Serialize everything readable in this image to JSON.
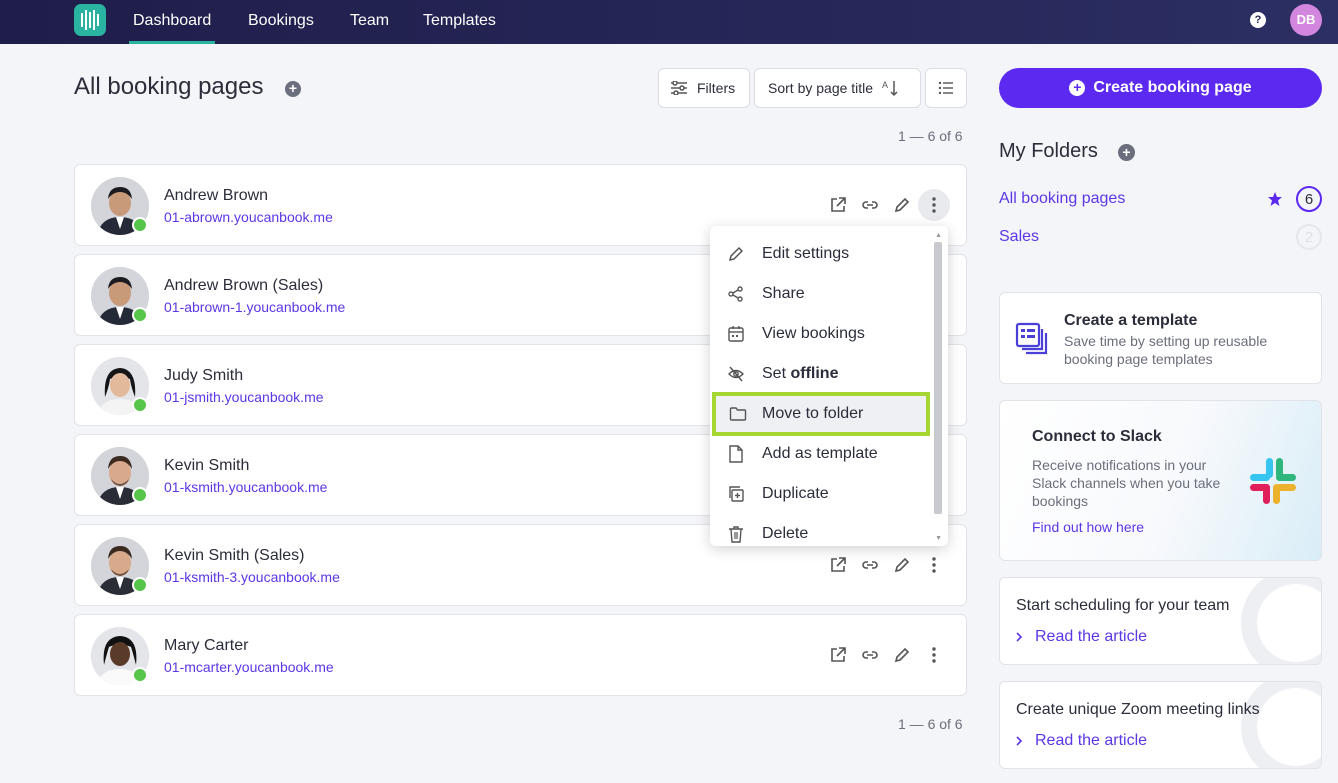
{
  "nav": {
    "items": [
      "Dashboard",
      "Bookings",
      "Team",
      "Templates"
    ],
    "help_label": "?",
    "user_initials": "DB"
  },
  "header": {
    "title": "All booking pages",
    "filters_label": "Filters",
    "sort_label": "Sort by page title",
    "count_top": "1 — 6 of 6",
    "count_bottom": "1 — 6 of 6"
  },
  "rows": [
    {
      "name": "Andrew Brown",
      "url": "01-abrown.youcanbook.me"
    },
    {
      "name": "Andrew Brown (Sales)",
      "url": "01-abrown-1.youcanbook.me"
    },
    {
      "name": "Judy Smith",
      "url": "01-jsmith.youcanbook.me"
    },
    {
      "name": "Kevin Smith",
      "url": "01-ksmith.youcanbook.me"
    },
    {
      "name": "Kevin Smith (Sales)",
      "url": "01-ksmith-3.youcanbook.me"
    },
    {
      "name": "Mary Carter",
      "url": "01-mcarter.youcanbook.me"
    }
  ],
  "menu": {
    "edit": "Edit settings",
    "share": "Share",
    "view": "View bookings",
    "offline_prefix": "Set ",
    "offline_bold": "offline",
    "move": "Move to folder",
    "template": "Add as template",
    "duplicate": "Duplicate",
    "delete": "Delete"
  },
  "sidebar": {
    "create_label": "Create booking page",
    "folders_title": "My Folders",
    "folders": [
      {
        "name": "All booking pages",
        "count": "6"
      },
      {
        "name": "Sales",
        "count": "2"
      }
    ],
    "template_card": {
      "title": "Create a template",
      "desc": "Save time by setting up reusable booking page templates"
    },
    "slack_card": {
      "title": "Connect to Slack",
      "desc": "Receive notifications in your Slack channels when you take bookings",
      "link": "Find out how here"
    },
    "article1": {
      "title": "Start scheduling for your team",
      "link": "Read the article"
    },
    "article2": {
      "title": "Create unique Zoom meeting links",
      "link": "Read the article"
    }
  },
  "colors": {
    "accent": "#5b29ef",
    "link": "#5b37e6",
    "nav_bg": "#262758",
    "teal": "#2bb3a1",
    "online": "#56c54a",
    "highlight": "#a6d631"
  }
}
